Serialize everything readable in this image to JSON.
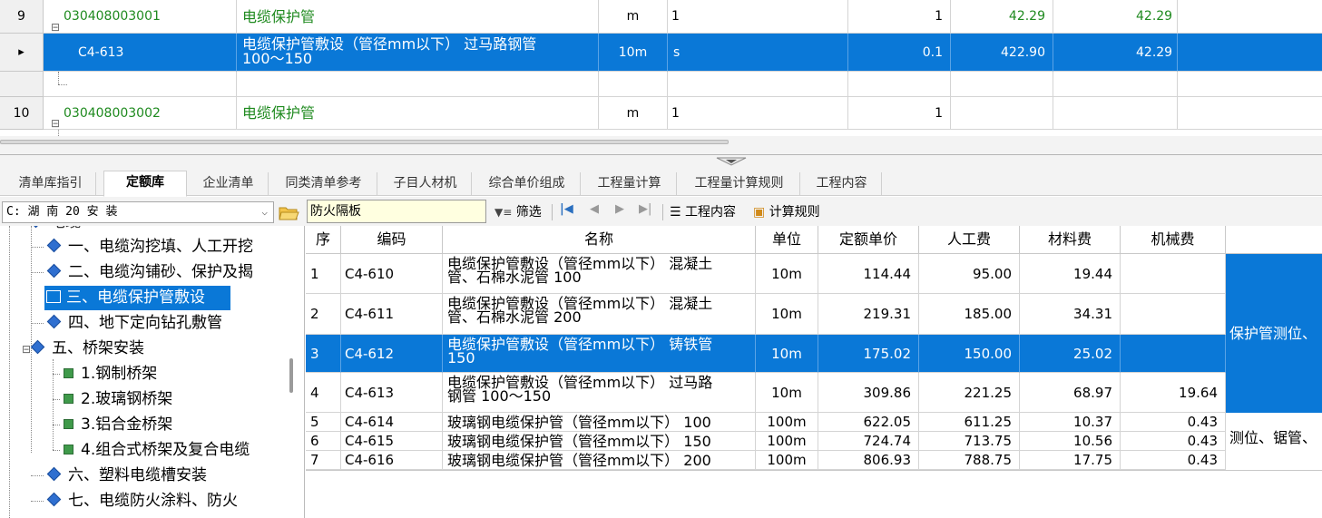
{
  "top_grid": {
    "rows": [
      {
        "num": "9",
        "code": "030408003001",
        "name": "电缆保护管",
        "unit": "m",
        "expr": "1",
        "qty": "1",
        "price": "42.29",
        "total": "42.29"
      },
      {
        "num": "",
        "code": "C4-613",
        "name_line1": "电缆保护管敷设（管径mm以下） 过马路钢管",
        "name_line2": "100～150",
        "unit": "10m",
        "expr": "s",
        "qty": "0.1",
        "price": "422.90",
        "total": "42.29"
      },
      {
        "num": "10",
        "code": "030408003002",
        "name": "电缆保护管",
        "unit": "m",
        "expr": "1",
        "qty": "1"
      }
    ],
    "row_indicator": "▸"
  },
  "tabs": [
    "清单库指引",
    "定额库",
    "企业清单",
    "同类清单参考",
    "子目人材机",
    "综合单价组成",
    "工程量计算",
    "工程量计算规则",
    "工程内容"
  ],
  "toolbar": {
    "library": "C: 湖 南 20 安 装",
    "search_value": "防火隔板",
    "filter_label": "筛选",
    "content_label": "工程内容",
    "calc_rule_label": "计算规则"
  },
  "tree": {
    "partial_top": "电缆",
    "items": [
      {
        "label": "一、电缆沟挖填、人工开挖"
      },
      {
        "label": "二、电缆沟铺砂、保护及揭"
      },
      {
        "label": "三、电缆保护管敷设"
      },
      {
        "label": "四、地下定向钻孔敷管"
      },
      {
        "label": "五、桥架安装"
      },
      {
        "label": "1.钢制桥架"
      },
      {
        "label": "2.玻璃钢桥架"
      },
      {
        "label": "3.铝合金桥架"
      },
      {
        "label": "4.组合式桥架及复合电缆"
      },
      {
        "label": "六、塑料电缆槽安装"
      },
      {
        "label": "七、电缆防火涂料、防火"
      }
    ]
  },
  "grid": {
    "headers": [
      "序",
      "编码",
      "名称",
      "单位",
      "定额单价",
      "人工费",
      "材料费",
      "机械费"
    ],
    "rows": [
      {
        "seq": "1",
        "code": "C4-610",
        "name1": "电缆保护管敷设（管径mm以下） 混凝土",
        "name2": "管、石棉水泥管 100",
        "unit": "10m",
        "price": "114.44",
        "labor": "95.00",
        "material": "19.44",
        "machine": ""
      },
      {
        "seq": "2",
        "code": "C4-611",
        "name1": "电缆保护管敷设（管径mm以下） 混凝土",
        "name2": "管、石棉水泥管 200",
        "unit": "10m",
        "price": "219.31",
        "labor": "185.00",
        "material": "34.31",
        "machine": ""
      },
      {
        "seq": "3",
        "code": "C4-612",
        "name1": "电缆保护管敷设（管径mm以下） 铸铁管",
        "name2": "150",
        "unit": "10m",
        "price": "175.02",
        "labor": "150.00",
        "material": "25.02",
        "machine": ""
      },
      {
        "seq": "4",
        "code": "C4-613",
        "name1": "电缆保护管敷设（管径mm以下） 过马路",
        "name2": "钢管 100～150",
        "unit": "10m",
        "price": "309.86",
        "labor": "221.25",
        "material": "68.97",
        "machine": "19.64"
      },
      {
        "seq": "5",
        "code": "C4-614",
        "name1": "玻璃钢电缆保护管（管径mm以下） 100",
        "name2": "",
        "unit": "100m",
        "price": "622.05",
        "labor": "611.25",
        "material": "10.37",
        "machine": "0.43"
      },
      {
        "seq": "6",
        "code": "C4-615",
        "name1": "玻璃钢电缆保护管（管径mm以下） 150",
        "name2": "",
        "unit": "100m",
        "price": "724.74",
        "labor": "713.75",
        "material": "10.56",
        "machine": "0.43"
      },
      {
        "seq": "7",
        "code": "C4-616",
        "name1": "玻璃钢电缆保护管（管径mm以下） 200",
        "name2": "",
        "unit": "100m",
        "price": "806.93",
        "labor": "788.75",
        "material": "17.75",
        "machine": "0.43"
      }
    ],
    "merged_content_1": "保护管测位、",
    "merged_content_2": "测位、锯管、"
  }
}
